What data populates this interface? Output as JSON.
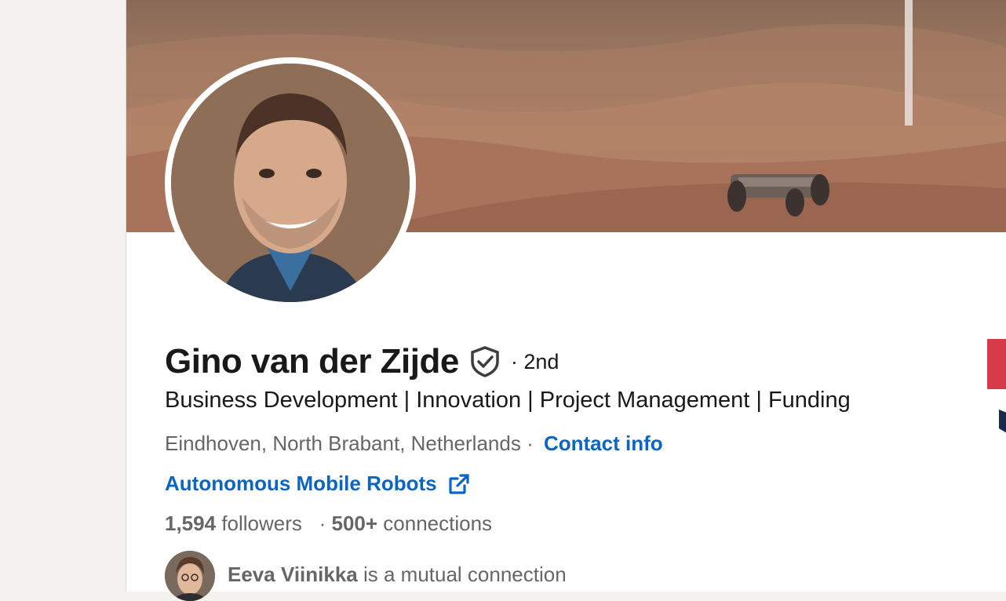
{
  "profile": {
    "name": "Gino van der Zijde",
    "degree": "· 2nd",
    "headline": "Business Development | Innovation | Project Management | Funding",
    "location": "Eindhoven, North Brabant, Netherlands",
    "location_separator": "·",
    "contact_label": "Contact info",
    "website_label": "Autonomous Mobile Robots",
    "followers_count": "1,594",
    "followers_label": "followers",
    "stats_separator": "·",
    "connections_count": "500+",
    "connections_label": "connections",
    "mutual_name": "Eeva Viinikka",
    "mutual_suffix": "is a mutual connection"
  },
  "icons": {
    "verified": "verified-shield-icon",
    "external_link": "external-link-icon"
  },
  "colors": {
    "link": "#0a66c2",
    "text_primary": "#191919",
    "text_secondary": "#666666",
    "page_bg": "#f3f2ef"
  }
}
